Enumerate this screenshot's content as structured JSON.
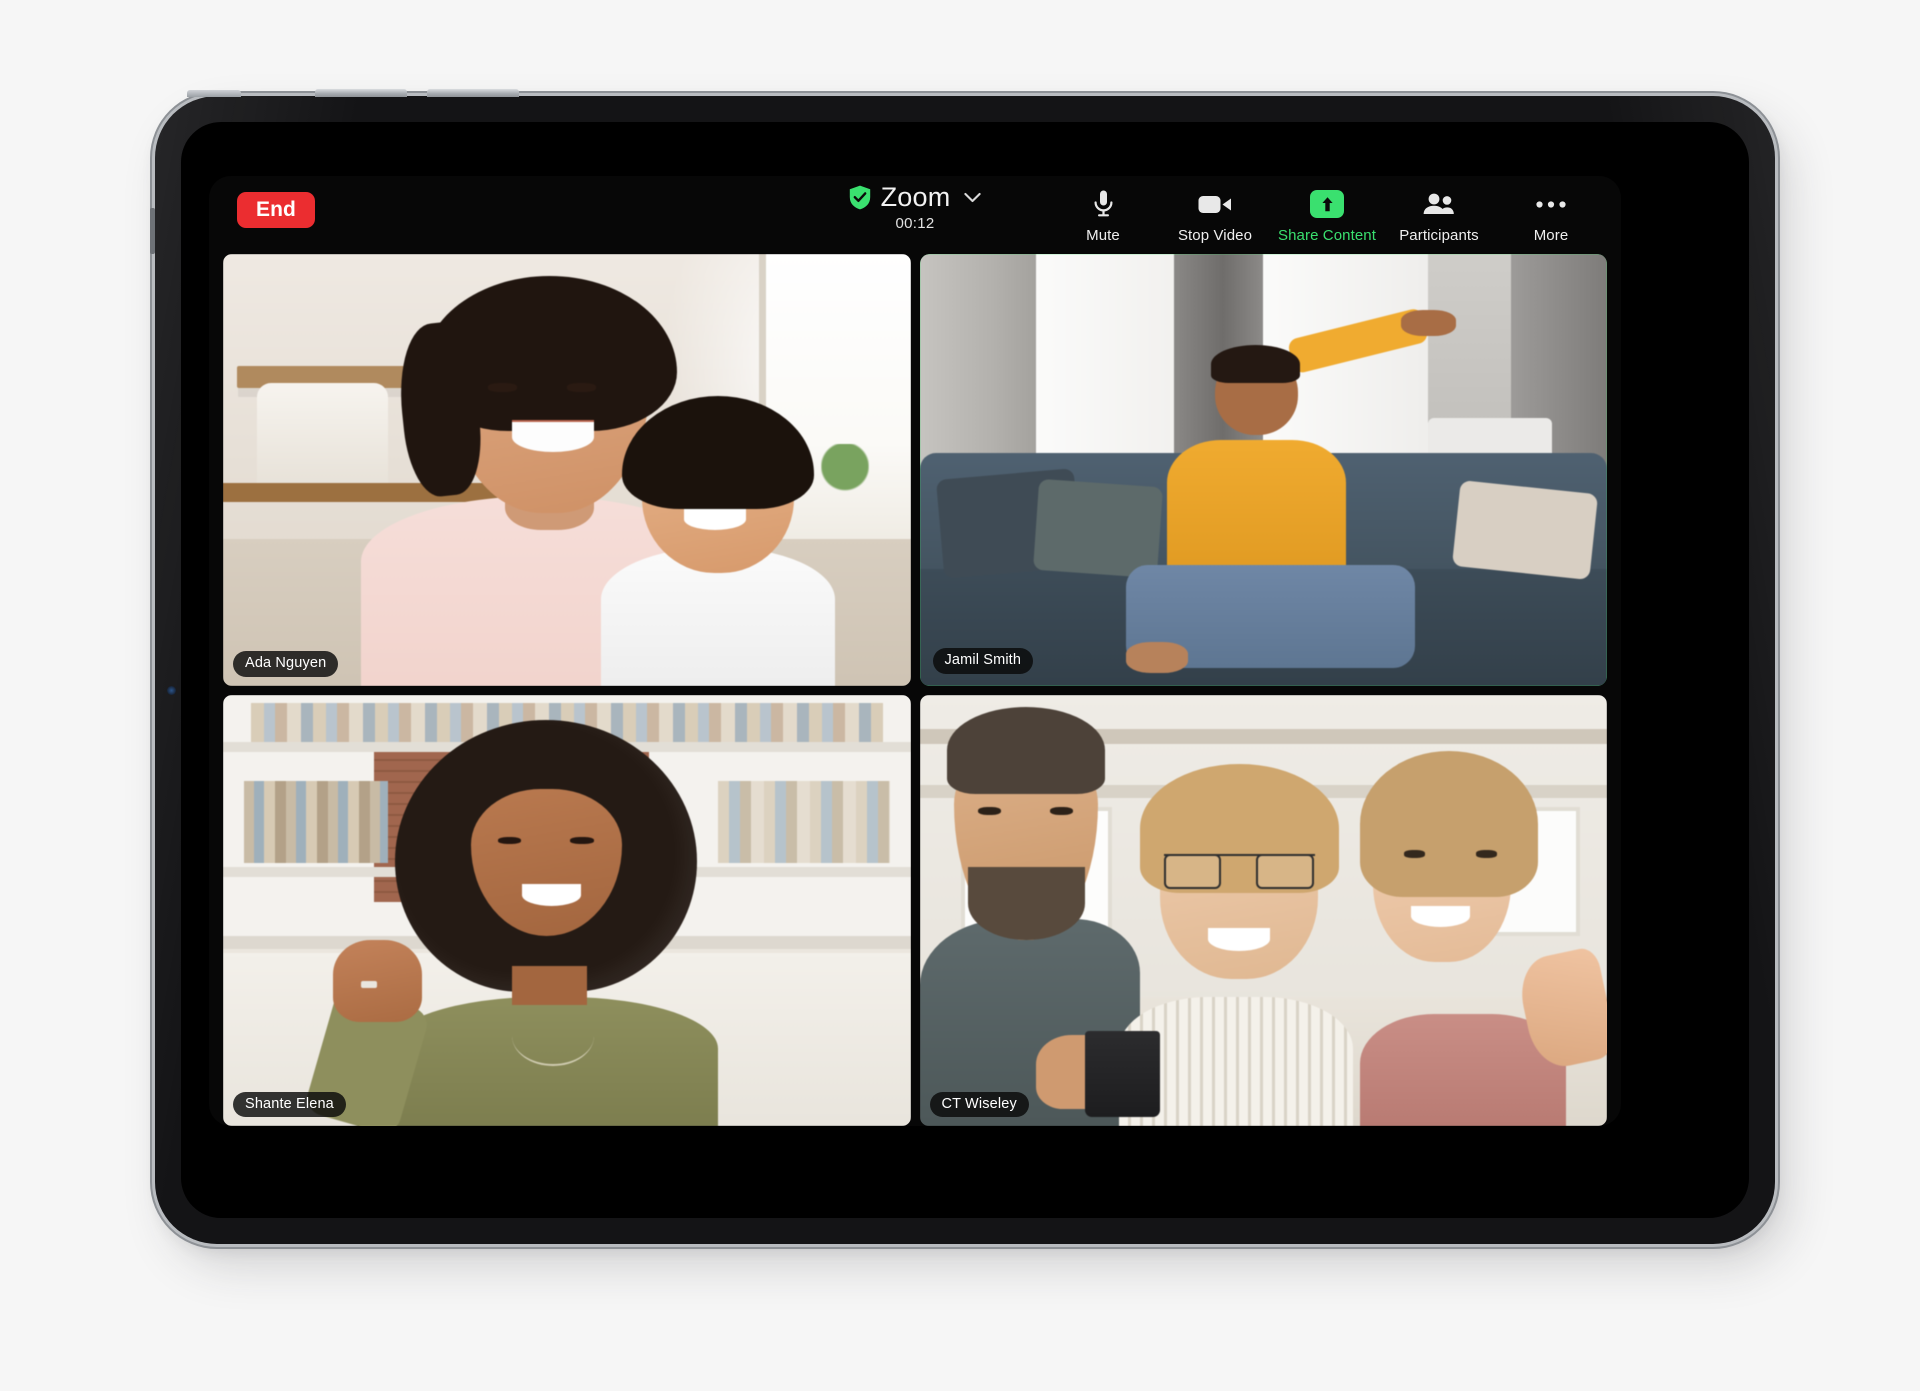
{
  "device": {
    "name": "iPad",
    "buttons": [
      "volume-up-button",
      "volume-down-button",
      "power-button"
    ]
  },
  "app": {
    "name": "Zoom",
    "toolbar": {
      "end_label": "End",
      "meeting_title": "Zoom",
      "timer": "00:12",
      "security_icon": "shield-check-icon",
      "dropdown_icon": "chevron-down-icon",
      "actions": [
        {
          "label": "Mute",
          "icon": "microphone-icon",
          "active": false
        },
        {
          "label": "Stop Video",
          "icon": "video-camera-icon",
          "active": false
        },
        {
          "label": "Share Content",
          "icon": "share-arrow-up-icon",
          "active": true
        },
        {
          "label": "Participants",
          "icon": "people-icon",
          "active": false
        },
        {
          "label": "More",
          "icon": "ellipsis-icon",
          "active": false
        }
      ]
    },
    "gallery": {
      "layout": "2x2-grid",
      "participants": [
        {
          "name": "Ada Nguyen",
          "speaking": false
        },
        {
          "name": "Jamil Smith",
          "speaking": true
        },
        {
          "name": "Shante Elena",
          "speaking": false
        },
        {
          "name": "CT Wiseley",
          "speaking": false
        }
      ]
    }
  },
  "colors": {
    "end_button_red": "#eb2d30",
    "accent_green": "#3ae06f",
    "speaking_border_green": "#31d85e",
    "app_background": "#070707",
    "device_bezel": "#141416",
    "page_background": "#f6f6f6"
  }
}
